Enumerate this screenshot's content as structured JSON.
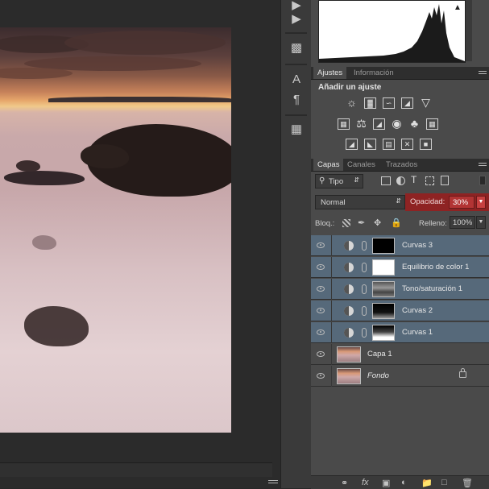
{
  "adjustments_panel": {
    "tabs": [
      "Ajustes",
      "Información"
    ],
    "title": "Añadir un ajuste",
    "icons_row1": [
      "brightness-icon",
      "levels-icon",
      "curves-icon",
      "exposure-icon",
      "vibrance-icon"
    ],
    "icons_row2": [
      "hue-saturation-icon",
      "color-balance-icon",
      "black-white-icon",
      "photo-filter-icon",
      "channel-mixer-icon",
      "color-lookup-icon"
    ],
    "icons_row3": [
      "invert-icon",
      "posterize-icon",
      "threshold-icon",
      "selective-color-icon",
      "gradient-map-icon"
    ]
  },
  "layers_panel": {
    "tabs": [
      "Capas",
      "Canales",
      "Trazados"
    ],
    "filter_kind": "Tipo",
    "blend_mode": "Normal",
    "opacity_label": "Opacidad:",
    "opacity_value": "30%",
    "lock_label": "Bloq.:",
    "fill_label": "Relleno:",
    "fill_value": "100%",
    "layers": [
      {
        "name": "Curvas 3",
        "type": "adjustment",
        "selected": true,
        "mask": "dark"
      },
      {
        "name": "Equilibrio de color 1",
        "type": "adjustment",
        "selected": true,
        "mask": "white"
      },
      {
        "name": "Tono/saturación 1",
        "type": "adjustment",
        "selected": true,
        "mask": "photo"
      },
      {
        "name": "Curvas 2",
        "type": "adjustment",
        "selected": true,
        "mask": "dark-gradient"
      },
      {
        "name": "Curvas 1",
        "type": "adjustment",
        "selected": true,
        "mask": "light-gradient"
      },
      {
        "name": "Capa 1",
        "type": "pixel",
        "selected": false
      },
      {
        "name": "Fondo",
        "type": "background",
        "selected": false,
        "locked": true
      }
    ]
  },
  "colors": {
    "panel_bg": "#4a4a4a",
    "selected_layer": "#56697a",
    "opacity_highlight": "#8e2323"
  }
}
